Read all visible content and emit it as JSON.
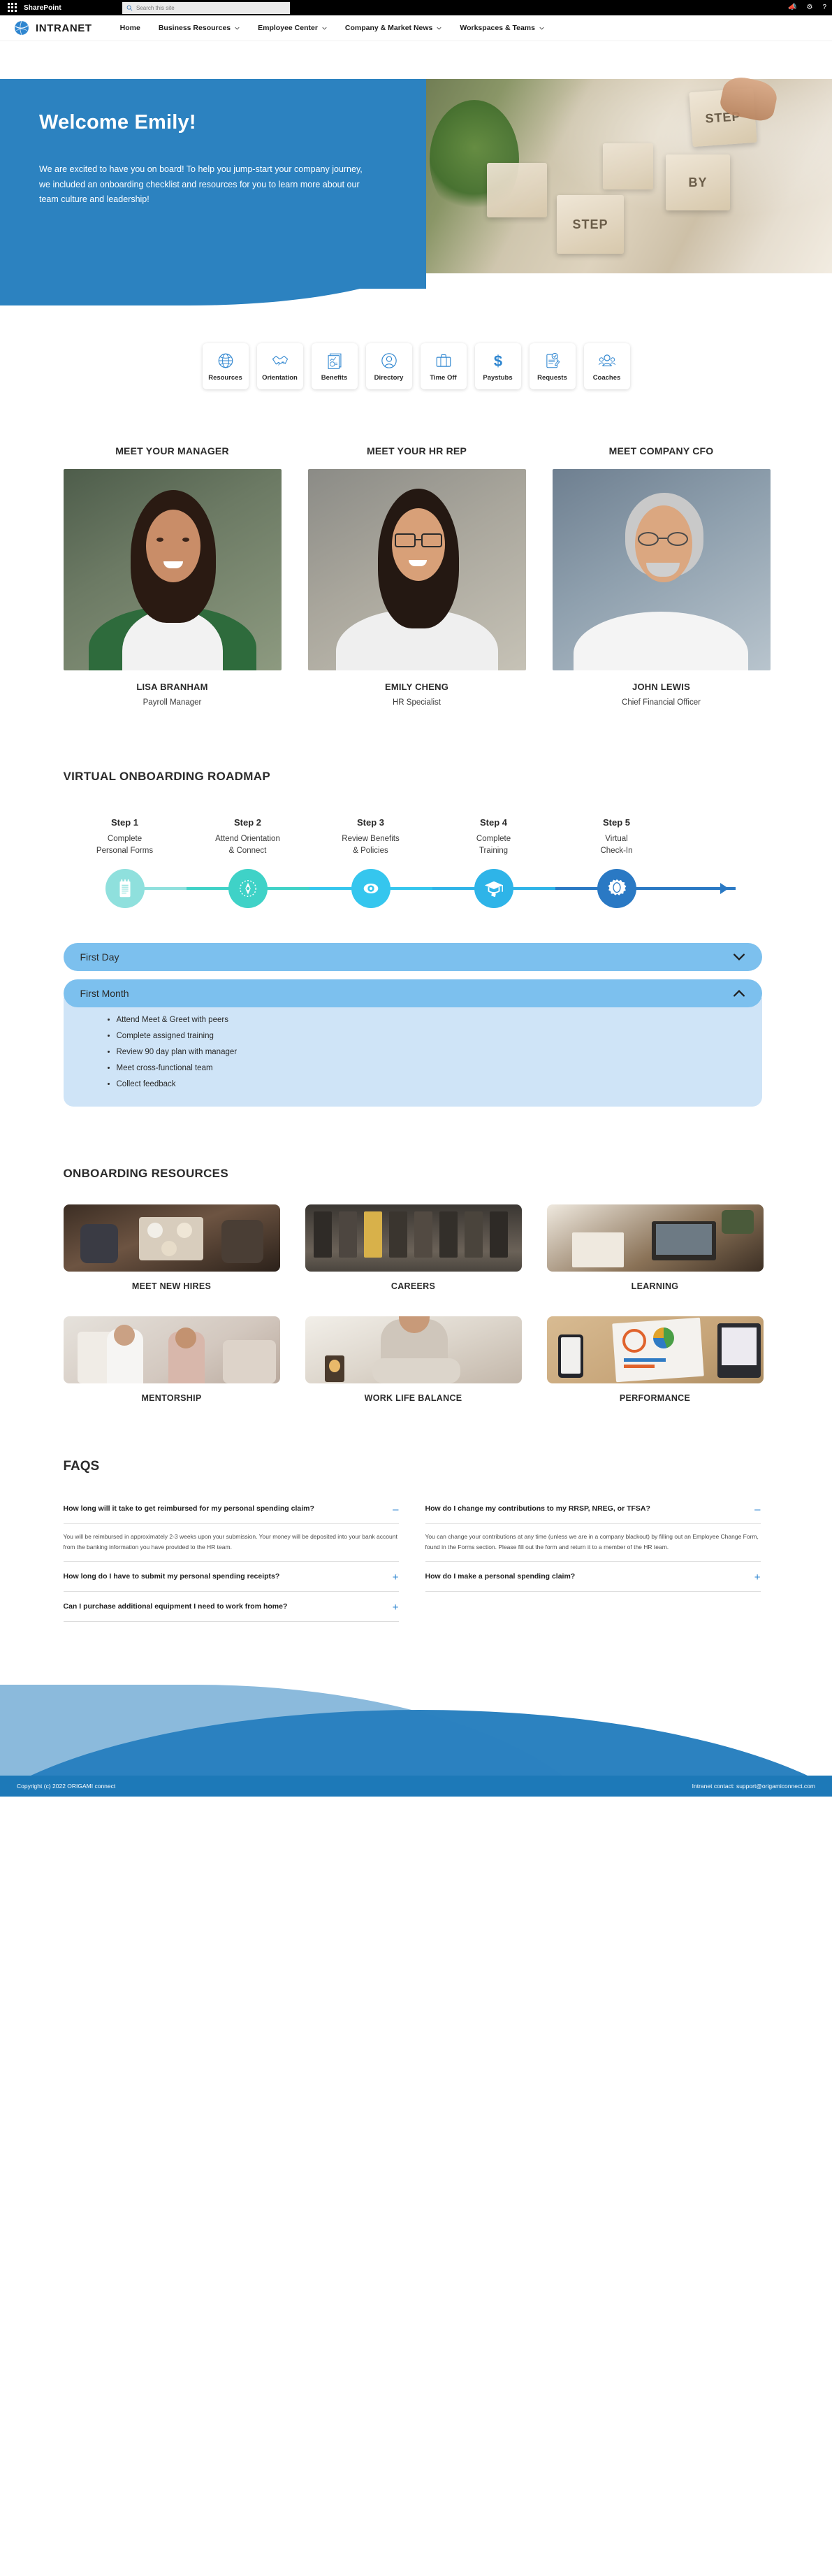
{
  "suitebar": {
    "app_title": "SharePoint",
    "search_placeholder": "Search this site",
    "icons": [
      "megaphone-icon",
      "gear-icon",
      "help-icon"
    ]
  },
  "sitenav": {
    "brand": "INTRANET",
    "links": [
      {
        "label": "Home",
        "has_chevron": false
      },
      {
        "label": "Business Resources",
        "has_chevron": true
      },
      {
        "label": "Employee Center",
        "has_chevron": true
      },
      {
        "label": "Company & Market News",
        "has_chevron": true
      },
      {
        "label": "Workspaces & Teams",
        "has_chevron": true
      }
    ]
  },
  "hero": {
    "title": "Welcome Emily!",
    "body": "We are excited to have you on board! To help you jump-start your company journey, we included an onboarding checklist and resources for you to learn more about our team culture and leadership!",
    "image_blocks": [
      "STEP",
      "BY",
      "STEP"
    ],
    "accent": "#2c82c0"
  },
  "quicklinks": [
    {
      "label": "Resources",
      "icon": "globe-icon"
    },
    {
      "label": "Orientation",
      "icon": "handshake-icon"
    },
    {
      "label": "Benefits",
      "icon": "report-documents-icon"
    },
    {
      "label": "Directory",
      "icon": "person-circle-icon"
    },
    {
      "label": "Time Off",
      "icon": "briefcase-icon"
    },
    {
      "label": "Paystubs",
      "icon": "dollar-sign-icon"
    },
    {
      "label": "Requests",
      "icon": "clipboard-pencil-icon"
    },
    {
      "label": "Coaches",
      "icon": "people-group-icon"
    }
  ],
  "people": [
    {
      "heading": "MEET YOUR MANAGER",
      "name": "LISA BRANHAM",
      "role": "Payroll Manager"
    },
    {
      "heading": "MEET YOUR HR REP",
      "name": "EMILY CHENG",
      "role": "HR Specialist"
    },
    {
      "heading": "MEET COMPANY CFO",
      "name": "JOHN LEWIS",
      "role": "Chief Financial Officer"
    }
  ],
  "roadmap": {
    "title": "VIRTUAL ONBOARDING ROADMAP",
    "steps": [
      {
        "step": "Step 1",
        "desc": "Complete\nPersonal Forms",
        "icon": "notepad-icon",
        "color": "#8fe0dd"
      },
      {
        "step": "Step 2",
        "desc": "Attend Orientation\n& Connect",
        "icon": "compass-icon",
        "color": "#3fd2c7"
      },
      {
        "step": "Step 3",
        "desc": "Review Benefits\n& Policies",
        "icon": "eye-icon",
        "color": "#35c6ee"
      },
      {
        "step": "Step 4",
        "desc": "Complete\nTraining",
        "icon": "graduation-cap-icon",
        "color": "#2eb4e8"
      },
      {
        "step": "Step 5",
        "desc": "Virtual\nCheck-In",
        "icon": "award-badge-icon",
        "color": "#2a79c4"
      }
    ]
  },
  "accordions": [
    {
      "label": "First Day",
      "expanded": false,
      "items": []
    },
    {
      "label": "First Month",
      "expanded": true,
      "items": [
        "Attend Meet & Greet with peers",
        "Complete assigned training",
        "Review 90 day plan with manager",
        "Meet cross-functional team",
        "Collect feedback"
      ]
    }
  ],
  "resources": {
    "title": "ONBOARDING RESOURCES",
    "items": [
      {
        "caption": "MEET NEW HIRES"
      },
      {
        "caption": "CAREERS"
      },
      {
        "caption": "LEARNING"
      },
      {
        "caption": "MENTORSHIP"
      },
      {
        "caption": "WORK LIFE BALANCE"
      },
      {
        "caption": "PERFORMANCE"
      }
    ]
  },
  "faq": {
    "title": "FAQS",
    "left": [
      {
        "question": "How long will it take to get reimbursed for my personal spending claim?",
        "expanded": true,
        "toggle": "–",
        "answer": "You will be reimbursed in approximately 2-3 weeks upon your submission. Your money will be deposited into your bank account from the banking information you have provided to the HR team."
      },
      {
        "question": "How long do I have to submit my personal spending receipts?",
        "expanded": false,
        "toggle": "+",
        "answer": ""
      },
      {
        "question": "Can I purchase additional equipment I need to work from home?",
        "expanded": false,
        "toggle": "+",
        "answer": ""
      }
    ],
    "right": [
      {
        "question": "How do I change my contributions to my RRSP, NREG, or TFSA?",
        "expanded": true,
        "toggle": "–",
        "answer": "You can change your contributions at any time (unless we are in a company blackout) by filling out an Employee Change Form, found in the Forms section. Please fill out the form and return it to a member of the HR team."
      },
      {
        "question": "How do I make a personal spending claim?",
        "expanded": false,
        "toggle": "+",
        "answer": ""
      }
    ]
  },
  "footer": {
    "copyright": "Copyright (c) 2022 ORIGAMI connect",
    "contact": "Intranet contact: support@origamiconnect.com"
  }
}
